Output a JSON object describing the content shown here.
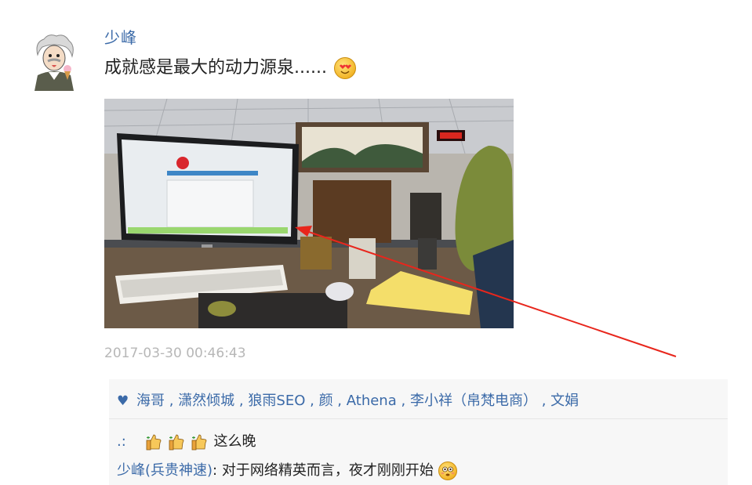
{
  "post": {
    "username": "少峰",
    "text": "成就感是最大的动力源泉......",
    "text_emoji": "heart-eyes-emoji",
    "timestamp": "2017-03-30 00:46:43",
    "photo_icon": "office-desk-photo"
  },
  "likes": {
    "icon": "heart-icon",
    "names": [
      "海哥",
      "潇然倾城",
      "狼雨SEO",
      "颜",
      "Athena",
      "李小祥（帛梵电商）",
      "文娟"
    ],
    "separator": ","
  },
  "comments": [
    {
      "author": ".:",
      "thumbs": 3,
      "text": "这么晚",
      "emoji": ""
    },
    {
      "author": "少峰(兵贵神速)",
      "colon": ":",
      "text": "对于网络精英而言，夜才刚刚开始",
      "emoji": "flushed-emoji"
    }
  ],
  "colors": {
    "link": "#3b6aa8",
    "timestamp": "#b7b7b7",
    "panel_bg": "#f7f7f7",
    "annotation_arrow": "#e8261c"
  }
}
